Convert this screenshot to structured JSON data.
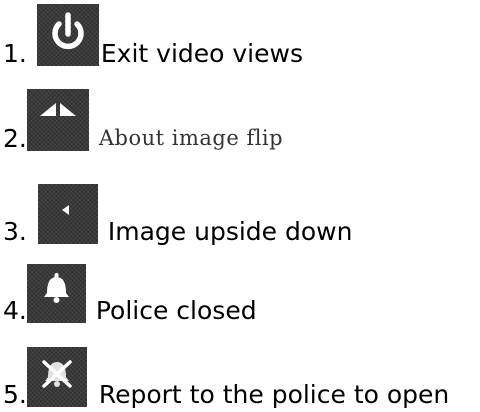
{
  "items": [
    {
      "number": "1.",
      "label": "Exit video views",
      "icon": "power-icon"
    },
    {
      "number": "2.",
      "label": "About image flip",
      "icon": "flip-horizontal-icon"
    },
    {
      "number": "3.",
      "label": "Image upside down",
      "icon": "arrow-left-icon"
    },
    {
      "number": "4.",
      "label": "Police closed",
      "icon": "bell-icon"
    },
    {
      "number": "5.",
      "label": "Report to the police to open",
      "icon": "bell-muted-icon"
    }
  ]
}
